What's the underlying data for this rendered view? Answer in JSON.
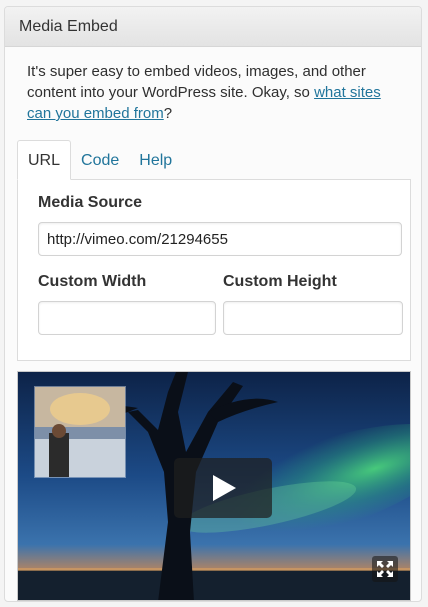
{
  "widget": {
    "title": "Media Embed"
  },
  "intro": {
    "text_before": "It's super easy to embed videos, images, and other content into your WordPress site. Okay, so ",
    "link_text": "what sites can you embed from",
    "text_after": "?"
  },
  "tabs": [
    {
      "label": "URL",
      "active": true
    },
    {
      "label": "Code",
      "active": false
    },
    {
      "label": "Help",
      "active": false
    }
  ],
  "form": {
    "media_source_label": "Media Source",
    "media_source_value": "http://vimeo.com/21294655",
    "custom_width_label": "Custom Width",
    "custom_width_value": "",
    "custom_height_label": "Custom Height",
    "custom_height_value": ""
  },
  "colors": {
    "link": "#21759b",
    "header_bg": "#e8e8e8",
    "panel_border": "#dcdcdc"
  },
  "video": {
    "play_icon": "play-icon",
    "fullscreen_icon": "fullscreen-icon"
  }
}
